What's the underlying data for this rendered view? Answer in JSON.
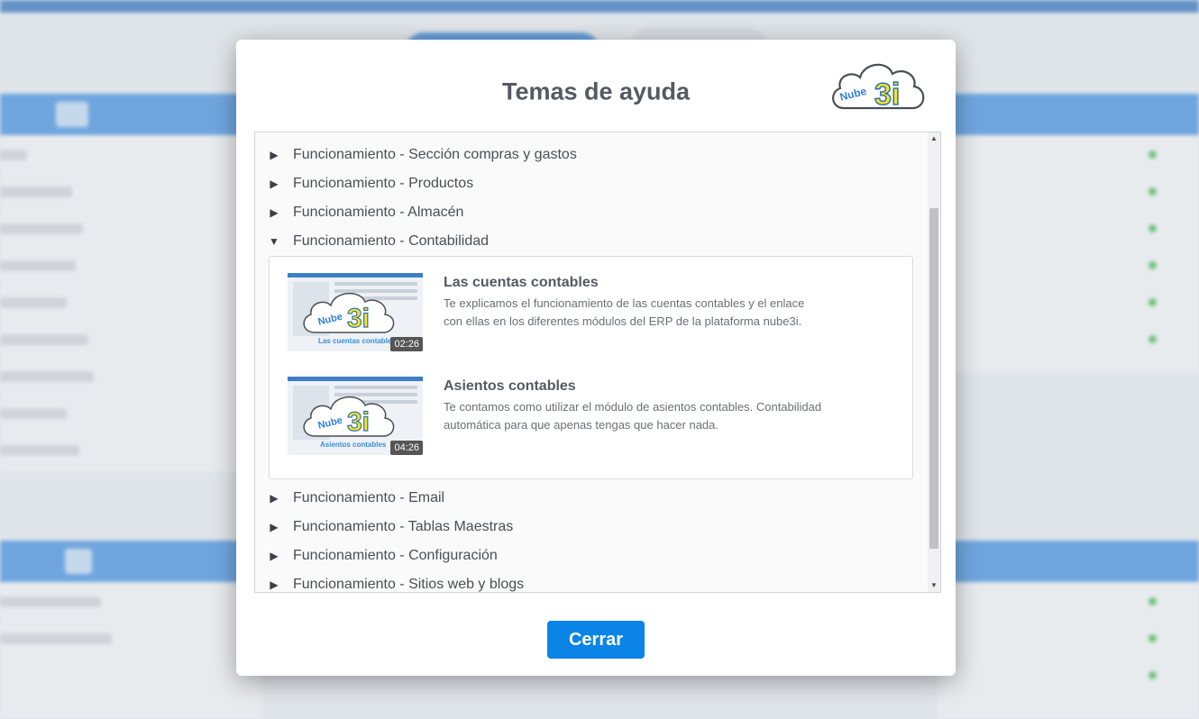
{
  "modal": {
    "title": "Temas de ayuda",
    "logo_text": "Nube 3i",
    "close_label": "Cerrar"
  },
  "topics": [
    {
      "label": "Funcionamiento - Sección compras y gastos",
      "expanded": false
    },
    {
      "label": "Funcionamiento - Productos",
      "expanded": false
    },
    {
      "label": "Funcionamiento - Almacén",
      "expanded": false
    },
    {
      "label": "Funcionamiento - Contabilidad",
      "expanded": true
    },
    {
      "label": "Funcionamiento - Email",
      "expanded": false
    },
    {
      "label": "Funcionamiento - Tablas Maestras",
      "expanded": false
    },
    {
      "label": "Funcionamiento - Configuración",
      "expanded": false
    },
    {
      "label": "Funcionamiento - Sitios web y blogs",
      "expanded": false
    }
  ],
  "videos": [
    {
      "title": "Las cuentas contables",
      "description": "Te explicamos el funcionamiento de las cuentas contables y el enlace con ellas en los diferentes módulos del ERP de la plataforma nube3i.",
      "duration": "02:26",
      "thumb_caption": "Las cuentas contables"
    },
    {
      "title": "Asientos contables",
      "description": "Te contamos como utilizar el módulo de asientos contables. Contabilidad automática para que apenas tengas que hacer nada.",
      "duration": "04:26",
      "thumb_caption": "Asientos contables"
    }
  ],
  "icons": {
    "expand": "triangle-right-icon",
    "collapse": "triangle-down-icon"
  },
  "colors": {
    "primary_button": "#0b84e8",
    "brand_blue": "#3c8ce0",
    "logo_yellow": "#f6e71c"
  }
}
